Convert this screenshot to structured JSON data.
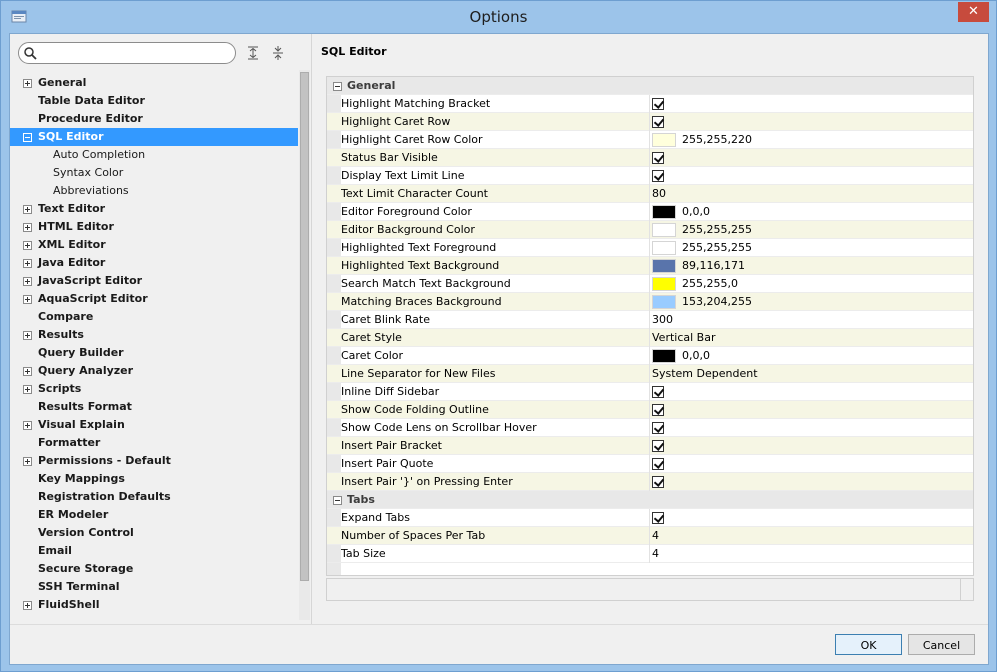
{
  "window": {
    "title": "Options",
    "close_glyph": "✕"
  },
  "search": {
    "value": "",
    "placeholder": ""
  },
  "tree": [
    {
      "label": "General",
      "expander": "plus",
      "bold": true,
      "child": false,
      "selected": false
    },
    {
      "label": "Table Data Editor",
      "expander": "none",
      "bold": true,
      "child": false,
      "selected": false
    },
    {
      "label": "Procedure Editor",
      "expander": "none",
      "bold": true,
      "child": false,
      "selected": false
    },
    {
      "label": "SQL Editor",
      "expander": "minus",
      "bold": true,
      "child": false,
      "selected": true
    },
    {
      "label": "Auto Completion",
      "expander": "none",
      "bold": false,
      "child": true,
      "selected": false
    },
    {
      "label": "Syntax Color",
      "expander": "none",
      "bold": false,
      "child": true,
      "selected": false
    },
    {
      "label": "Abbreviations",
      "expander": "none",
      "bold": false,
      "child": true,
      "selected": false
    },
    {
      "label": "Text Editor",
      "expander": "plus",
      "bold": true,
      "child": false,
      "selected": false
    },
    {
      "label": "HTML Editor",
      "expander": "plus",
      "bold": true,
      "child": false,
      "selected": false
    },
    {
      "label": "XML Editor",
      "expander": "plus",
      "bold": true,
      "child": false,
      "selected": false
    },
    {
      "label": "Java Editor",
      "expander": "plus",
      "bold": true,
      "child": false,
      "selected": false
    },
    {
      "label": "JavaScript Editor",
      "expander": "plus",
      "bold": true,
      "child": false,
      "selected": false
    },
    {
      "label": "AquaScript Editor",
      "expander": "plus",
      "bold": true,
      "child": false,
      "selected": false
    },
    {
      "label": "Compare",
      "expander": "none",
      "bold": true,
      "child": false,
      "selected": false
    },
    {
      "label": "Results",
      "expander": "plus",
      "bold": true,
      "child": false,
      "selected": false
    },
    {
      "label": "Query Builder",
      "expander": "none",
      "bold": true,
      "child": false,
      "selected": false
    },
    {
      "label": "Query Analyzer",
      "expander": "plus",
      "bold": true,
      "child": false,
      "selected": false
    },
    {
      "label": "Scripts",
      "expander": "plus",
      "bold": true,
      "child": false,
      "selected": false
    },
    {
      "label": "Results Format",
      "expander": "none",
      "bold": true,
      "child": false,
      "selected": false
    },
    {
      "label": "Visual Explain",
      "expander": "plus",
      "bold": true,
      "child": false,
      "selected": false
    },
    {
      "label": "Formatter",
      "expander": "none",
      "bold": true,
      "child": false,
      "selected": false
    },
    {
      "label": "Permissions - Default",
      "expander": "plus",
      "bold": true,
      "child": false,
      "selected": false
    },
    {
      "label": "Key Mappings",
      "expander": "none",
      "bold": true,
      "child": false,
      "selected": false
    },
    {
      "label": "Registration Defaults",
      "expander": "none",
      "bold": true,
      "child": false,
      "selected": false
    },
    {
      "label": "ER Modeler",
      "expander": "none",
      "bold": true,
      "child": false,
      "selected": false
    },
    {
      "label": "Version Control",
      "expander": "none",
      "bold": true,
      "child": false,
      "selected": false
    },
    {
      "label": "Email",
      "expander": "none",
      "bold": true,
      "child": false,
      "selected": false
    },
    {
      "label": "Secure Storage",
      "expander": "none",
      "bold": true,
      "child": false,
      "selected": false
    },
    {
      "label": "SSH Terminal",
      "expander": "none",
      "bold": true,
      "child": false,
      "selected": false
    },
    {
      "label": "FluidShell",
      "expander": "plus",
      "bold": true,
      "child": false,
      "selected": false
    }
  ],
  "panel_title": "SQL Editor",
  "properties": [
    {
      "type": "section",
      "name": "General"
    },
    {
      "type": "checkbox",
      "name": "Highlight Matching Bracket",
      "checked": true
    },
    {
      "type": "checkbox",
      "name": "Highlight Caret Row",
      "checked": true
    },
    {
      "type": "color",
      "name": "Highlight Caret Row Color",
      "color": "#ffffdc",
      "value": "255,255,220"
    },
    {
      "type": "checkbox",
      "name": "Status Bar Visible",
      "checked": true
    },
    {
      "type": "checkbox",
      "name": "Display Text Limit Line",
      "checked": true
    },
    {
      "type": "text",
      "name": "Text Limit Character Count",
      "value": "80"
    },
    {
      "type": "color",
      "name": "Editor Foreground Color",
      "color": "#000000",
      "value": "0,0,0"
    },
    {
      "type": "color",
      "name": "Editor Background Color",
      "color": "#ffffff",
      "value": "255,255,255"
    },
    {
      "type": "color",
      "name": "Highlighted Text Foreground",
      "color": "#ffffff",
      "value": "255,255,255"
    },
    {
      "type": "color",
      "name": "Highlighted Text Background",
      "color": "#5974ab",
      "value": "89,116,171"
    },
    {
      "type": "color",
      "name": "Search Match Text Background",
      "color": "#ffff00",
      "value": "255,255,0"
    },
    {
      "type": "color",
      "name": "Matching Braces Background",
      "color": "#99ccff",
      "value": "153,204,255"
    },
    {
      "type": "text",
      "name": "Caret Blink Rate",
      "value": "300"
    },
    {
      "type": "text",
      "name": "Caret Style",
      "value": "Vertical Bar"
    },
    {
      "type": "color",
      "name": "Caret Color",
      "color": "#000000",
      "value": "0,0,0"
    },
    {
      "type": "text",
      "name": "Line Separator for New Files",
      "value": "System Dependent"
    },
    {
      "type": "checkbox",
      "name": "Inline Diff Sidebar",
      "checked": true
    },
    {
      "type": "checkbox",
      "name": "Show Code Folding Outline",
      "checked": true
    },
    {
      "type": "checkbox",
      "name": "Show Code Lens on Scrollbar Hover",
      "checked": true
    },
    {
      "type": "checkbox",
      "name": "Insert Pair Bracket",
      "checked": true
    },
    {
      "type": "checkbox",
      "name": "Insert Pair Quote",
      "checked": true
    },
    {
      "type": "checkbox",
      "name": "Insert Pair '}' on Pressing Enter",
      "checked": true
    },
    {
      "type": "section",
      "name": "Tabs"
    },
    {
      "type": "checkbox",
      "name": "Expand Tabs",
      "checked": true
    },
    {
      "type": "text",
      "name": "Number of Spaces Per Tab",
      "value": "4"
    },
    {
      "type": "text",
      "name": "Tab Size",
      "value": "4"
    }
  ],
  "buttons": {
    "ok": "OK",
    "cancel": "Cancel"
  },
  "colors": {
    "selection": "#3399ff",
    "title_bar": "#9cc4ea",
    "close": "#c74b3d"
  }
}
